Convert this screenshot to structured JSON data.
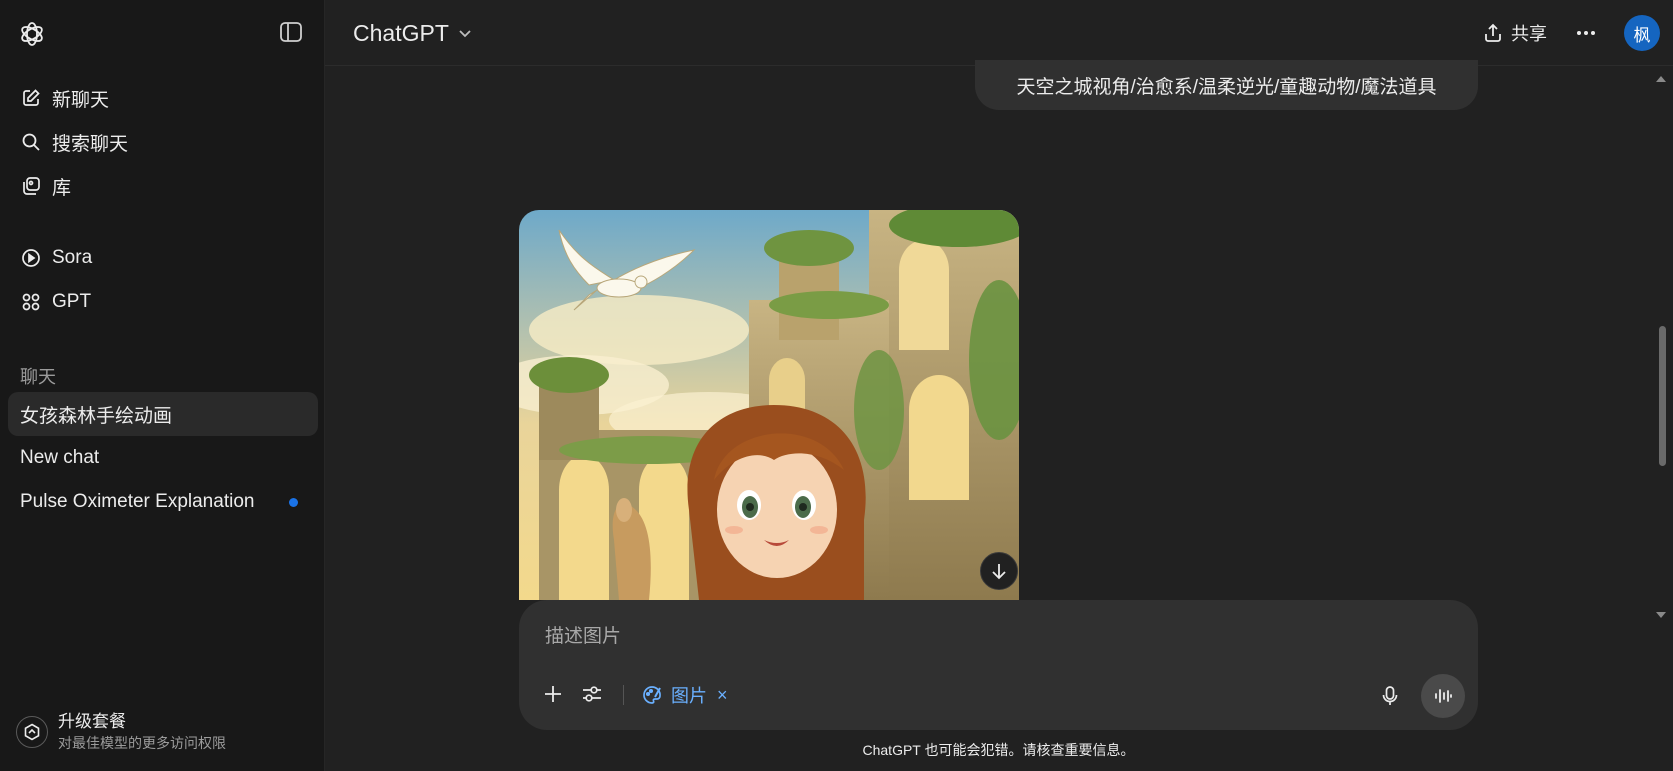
{
  "sidebar": {
    "items": [
      {
        "label": "新聊天",
        "icon": "edit-icon"
      },
      {
        "label": "搜索聊天",
        "icon": "search-icon"
      },
      {
        "label": "库",
        "icon": "library-icon"
      },
      {
        "label": "Sora",
        "icon": "play-circle-icon"
      },
      {
        "label": "GPT",
        "icon": "grid-icon"
      }
    ],
    "section_label": "聊天",
    "chats": [
      {
        "label": "女孩森林手绘动画",
        "active": true
      },
      {
        "label": "New chat",
        "active": false
      },
      {
        "label": "Pulse Oximeter Explanation",
        "active": false,
        "unread": true
      }
    ],
    "upgrade": {
      "title": "升级套餐",
      "subtitle": "对最佳模型的更多访问权限"
    }
  },
  "header": {
    "model": "ChatGPT",
    "share_label": "共享",
    "avatar_initial": "枫"
  },
  "chat": {
    "user_message": "天空之城视角/治愈系/温柔逆光/童趣动物/魔法道具",
    "image_icon": "generated-image"
  },
  "composer": {
    "placeholder": "描述图片",
    "tool_chip_label": "图片",
    "tool_chip_close": "×"
  },
  "disclaimer": "ChatGPT 也可能会犯错。请核查重要信息。",
  "colors": {
    "background": "#212121",
    "sidebar": "#181818",
    "accent_blue": "#6ab0ff",
    "avatar_blue": "#1565c0"
  }
}
